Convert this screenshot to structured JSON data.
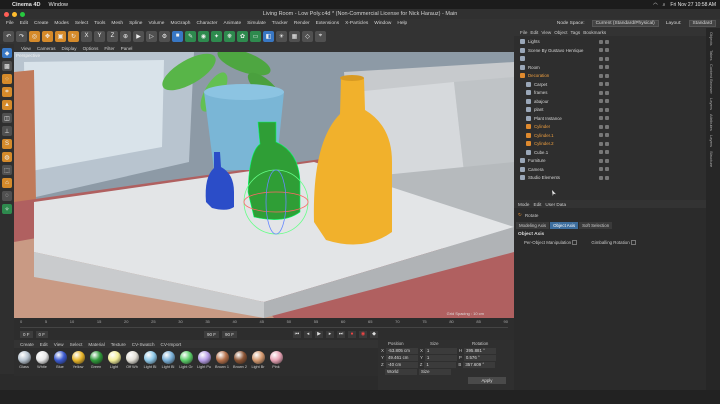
{
  "mac_menubar": {
    "app": "Cinema 4D",
    "window_menu": "Window",
    "datetime": "Fri Nov 27  10:58 AM"
  },
  "window_title": "Living Room - Low Poly.c4d * (Non-Commercial License for Nick Harauz) - Main",
  "app_menu": [
    "File",
    "Edit",
    "Create",
    "Modes",
    "Select",
    "Tools",
    "Mesh",
    "Spline",
    "Volume",
    "MoGraph",
    "Character",
    "Animate",
    "Simulate",
    "Tracker",
    "Render",
    "Extensions",
    "X-Particles",
    "Window",
    "Help"
  ],
  "node_space": {
    "label": "Node Space:",
    "value": "Current (Standard/Physical)",
    "layout_label": "Layout:",
    "layout_value": "Standard"
  },
  "toolbar_axes": [
    "X",
    "Y",
    "Z"
  ],
  "viewport": {
    "menu": [
      "View",
      "Cameras",
      "Display",
      "Options",
      "Filter",
      "Panel"
    ],
    "label": "Perspective",
    "grid_spacing": "Grid Spacing : 10 cm"
  },
  "timeline": {
    "ticks": [
      "0",
      "5",
      "10",
      "15",
      "20",
      "25",
      "30",
      "35",
      "40",
      "45",
      "50",
      "55",
      "60",
      "65",
      "70",
      "75",
      "80",
      "85",
      "90"
    ],
    "current_frame": "0 F",
    "start": "0 F",
    "end": "90 F",
    "end2": "90 F",
    "frame_readout": "0 F"
  },
  "materials": {
    "menu": [
      "Create",
      "Edit",
      "View",
      "Select",
      "Material",
      "Texture",
      "CV-Swatch",
      "CV-Import"
    ],
    "items": [
      {
        "name": "Glass",
        "color": "#b7c3cf"
      },
      {
        "name": "White",
        "color": "#e8e8e8"
      },
      {
        "name": "Blue",
        "color": "#3c5bd1"
      },
      {
        "name": "Yellow",
        "color": "#e9b62a"
      },
      {
        "name": "Green",
        "color": "#2f9a3a"
      },
      {
        "name": "Light",
        "color": "#f2ee9a"
      },
      {
        "name": "Off Wh",
        "color": "#e2dfd6"
      },
      {
        "name": "Light Bl",
        "color": "#8ec8e8"
      },
      {
        "name": "Light Bl",
        "color": "#7ab0d8"
      },
      {
        "name": "Light Gr",
        "color": "#5ccf6a"
      },
      {
        "name": "Light Pu",
        "color": "#b79ee6"
      },
      {
        "name": "Brown 1",
        "color": "#b5704a"
      },
      {
        "name": "Brown 2",
        "color": "#8c5535"
      },
      {
        "name": "Light Br",
        "color": "#d59a70"
      },
      {
        "name": "Pink",
        "color": "#e7a2b4"
      }
    ]
  },
  "coordinates": {
    "headers": [
      "Position",
      "Size",
      "Rotation"
    ],
    "rows": [
      {
        "axis": "X",
        "pos": "-53.805 cm",
        "size_axis": "X",
        "size": "1",
        "rot_axis": "H",
        "rot": "395.881 °"
      },
      {
        "axis": "Y",
        "pos": "49.461 cm",
        "size_axis": "Y",
        "size": "1",
        "rot_axis": "P",
        "rot": "0.576 °"
      },
      {
        "axis": "Z",
        "pos": "-40 cm",
        "size_axis": "Z",
        "size": "1",
        "rot_axis": "B",
        "rot": "357.609 °"
      }
    ],
    "mode": "World",
    "size_mode": "Size",
    "apply": "Apply"
  },
  "object_manager": {
    "tabs": [
      "File",
      "Edit",
      "View",
      "Object",
      "Tags",
      "Bookmarks"
    ],
    "items": [
      {
        "name": "Lights",
        "depth": 0,
        "color": "#9aa7b8"
      },
      {
        "name": "Scene By Gustavo Henrique",
        "depth": 0,
        "color": "#9aa7b8"
      },
      {
        "name": "",
        "depth": 0,
        "color": "#9aa7b8"
      },
      {
        "name": "Room",
        "depth": 0,
        "color": "#9aa7b8"
      },
      {
        "name": "Decoration",
        "depth": 0,
        "color": "#e08a2e"
      },
      {
        "name": "Carpet",
        "depth": 1,
        "color": "#9aa7b8"
      },
      {
        "name": "frames",
        "depth": 1,
        "color": "#9aa7b8"
      },
      {
        "name": "abajour",
        "depth": 1,
        "color": "#9aa7b8"
      },
      {
        "name": "plant",
        "depth": 1,
        "color": "#9aa7b8"
      },
      {
        "name": "Plant Instance",
        "depth": 1,
        "color": "#9aa7b8"
      },
      {
        "name": "Cylinder",
        "depth": 1,
        "color": "#e08a2e"
      },
      {
        "name": "Cylinder.1",
        "depth": 1,
        "color": "#e08a2e"
      },
      {
        "name": "Cylinder.2",
        "depth": 1,
        "color": "#e08a2e"
      },
      {
        "name": "Cube.1",
        "depth": 1,
        "color": "#9aa7b8"
      },
      {
        "name": "Furniture",
        "depth": 0,
        "color": "#9aa7b8"
      },
      {
        "name": "Camera",
        "depth": 0,
        "color": "#9aa7b8"
      },
      {
        "name": "Studio Elements",
        "depth": 0,
        "color": "#9aa7b8"
      }
    ]
  },
  "attributes": {
    "tabs": [
      "Mode",
      "Edit",
      "User Data"
    ],
    "object_name": "Rotate",
    "subtabs": [
      "Modeling Axis",
      "Object Axis",
      "Soft Selection"
    ],
    "active_subtab": "Object Axis",
    "section": "Object Axis",
    "options": [
      "Per-Object Manipulation",
      "Gimballing Rotation"
    ]
  },
  "side_tabs": [
    "Objects",
    "Takes",
    "Content Browser",
    "Layers",
    "Attributes",
    "Layers",
    "Structure"
  ]
}
